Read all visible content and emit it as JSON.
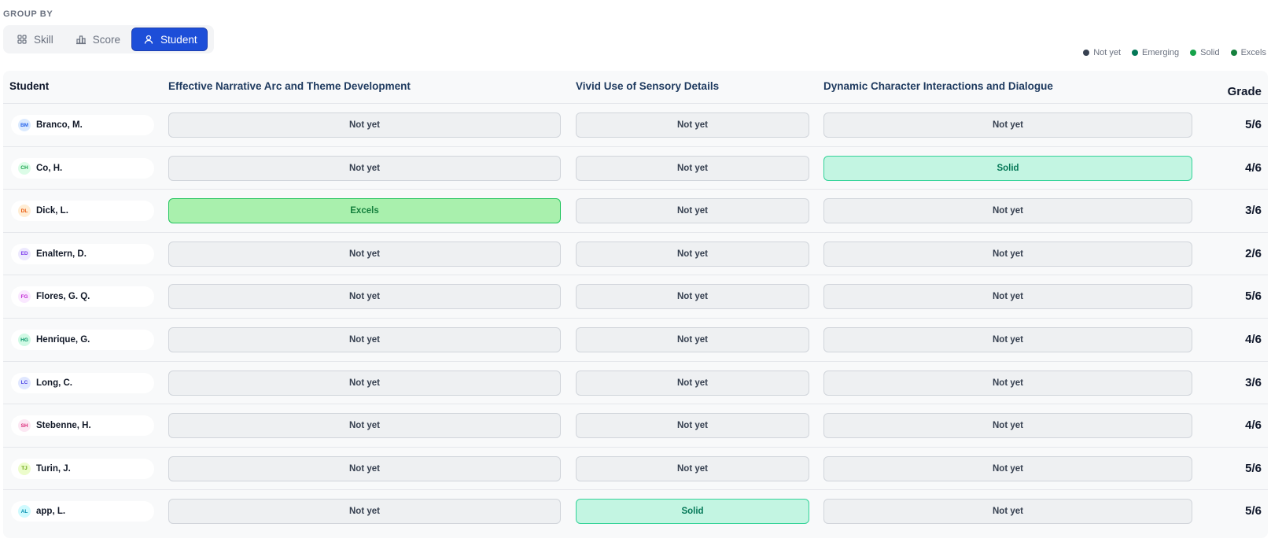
{
  "group_by": {
    "label": "GROUP BY",
    "options": [
      {
        "label": "Skill",
        "icon": "grid-icon",
        "active": false
      },
      {
        "label": "Score",
        "icon": "bar-chart-icon",
        "active": false
      },
      {
        "label": "Student",
        "icon": "user-icon",
        "active": true
      }
    ]
  },
  "legend": [
    {
      "label": "Not yet",
      "color": "#374151"
    },
    {
      "label": "Emerging",
      "color": "#047857"
    },
    {
      "label": "Solid",
      "color": "#16a34a"
    },
    {
      "label": "Excels",
      "color": "#15803d"
    }
  ],
  "table": {
    "headers": {
      "student": "Student",
      "skills": [
        "Effective Narrative Arc and Theme Development",
        "Vivid Use of Sensory Details",
        "Dynamic Character Interactions and Dialogue"
      ],
      "grade": "Grade"
    },
    "rows": [
      {
        "initials": "BM",
        "name": "Branco, M.",
        "avatar_bg": "#dbeafe",
        "avatar_fg": "#2563eb",
        "scores": [
          "Not yet",
          "Not yet",
          "Not yet"
        ],
        "grade": "5/6"
      },
      {
        "initials": "CH",
        "name": "Co, H.",
        "avatar_bg": "#dcfce7",
        "avatar_fg": "#16a34a",
        "scores": [
          "Not yet",
          "Not yet",
          "Solid"
        ],
        "grade": "4/6"
      },
      {
        "initials": "DL",
        "name": "Dick, L.",
        "avatar_bg": "#ffedd5",
        "avatar_fg": "#ea580c",
        "scores": [
          "Excels",
          "Not yet",
          "Not yet"
        ],
        "grade": "3/6"
      },
      {
        "initials": "ED",
        "name": "Enaltern, D.",
        "avatar_bg": "#ede9fe",
        "avatar_fg": "#7c3aed",
        "scores": [
          "Not yet",
          "Not yet",
          "Not yet"
        ],
        "grade": "2/6"
      },
      {
        "initials": "FG",
        "name": "Flores, G. Q.",
        "avatar_bg": "#fae8ff",
        "avatar_fg": "#c026d3",
        "scores": [
          "Not yet",
          "Not yet",
          "Not yet"
        ],
        "grade": "5/6"
      },
      {
        "initials": "HG",
        "name": "Henrique, G.",
        "avatar_bg": "#d1fae5",
        "avatar_fg": "#059669",
        "scores": [
          "Not yet",
          "Not yet",
          "Not yet"
        ],
        "grade": "4/6"
      },
      {
        "initials": "LC",
        "name": "Long, C.",
        "avatar_bg": "#e0e7ff",
        "avatar_fg": "#4f46e5",
        "scores": [
          "Not yet",
          "Not yet",
          "Not yet"
        ],
        "grade": "3/6"
      },
      {
        "initials": "SH",
        "name": "Stebenne, H.",
        "avatar_bg": "#fce7f3",
        "avatar_fg": "#db2777",
        "scores": [
          "Not yet",
          "Not yet",
          "Not yet"
        ],
        "grade": "4/6"
      },
      {
        "initials": "TJ",
        "name": "Turin, J.",
        "avatar_bg": "#ecfccb",
        "avatar_fg": "#65a30d",
        "scores": [
          "Not yet",
          "Not yet",
          "Not yet"
        ],
        "grade": "5/6"
      },
      {
        "initials": "AL",
        "name": "app, L.",
        "avatar_bg": "#cffafe",
        "avatar_fg": "#0891b2",
        "scores": [
          "Not yet",
          "Solid",
          "Not yet"
        ],
        "grade": "5/6"
      }
    ]
  }
}
